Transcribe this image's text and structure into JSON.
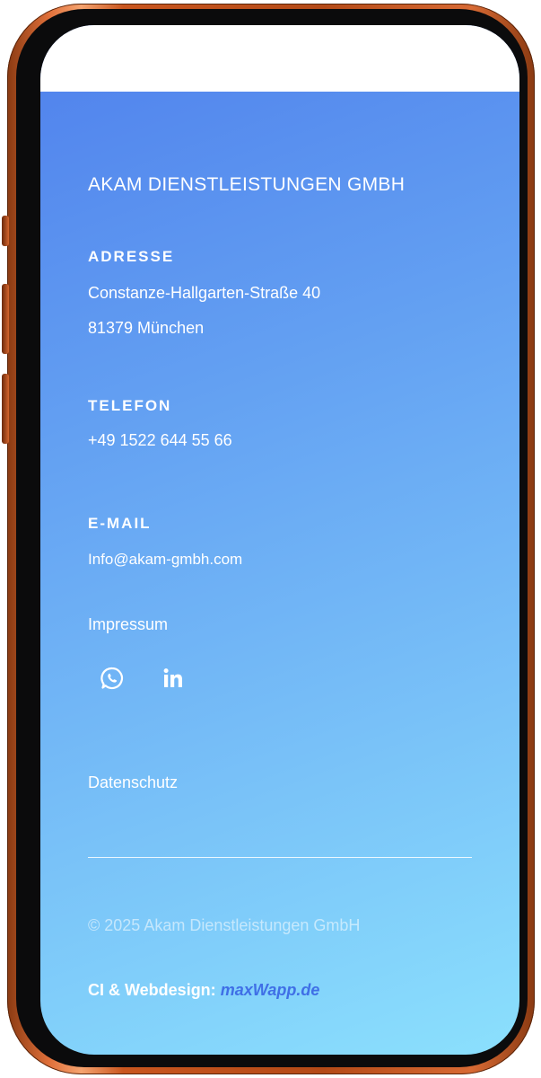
{
  "company": {
    "name": "AKAM DIENSTLEISTUNGEN GMBH"
  },
  "address": {
    "label": "ADRESSE",
    "street": "Constanze-Hallgarten-Straße 40",
    "city": "81379 München"
  },
  "phone": {
    "label": "TELEFON",
    "number": "+49 1522 644 55 66"
  },
  "email": {
    "label": "E-MAIL",
    "address": "Info@akam-gmbh.com"
  },
  "links": {
    "impressum": "Impressum",
    "datenschutz": "Datenschutz"
  },
  "social": [
    {
      "icon": "whatsapp-icon"
    },
    {
      "icon": "linkedin-icon"
    }
  ],
  "footer": {
    "copyright": "© 2025 Akam Dienstleistungen GmbH",
    "credit_prefix": "CI & Webdesign:",
    "credit_link": "maxWapp.de"
  },
  "colors": {
    "frame": "#c9561f",
    "gradient_start": "#4f80ec",
    "gradient_end": "#8be0fd",
    "credit_link": "#3f6fe6"
  }
}
